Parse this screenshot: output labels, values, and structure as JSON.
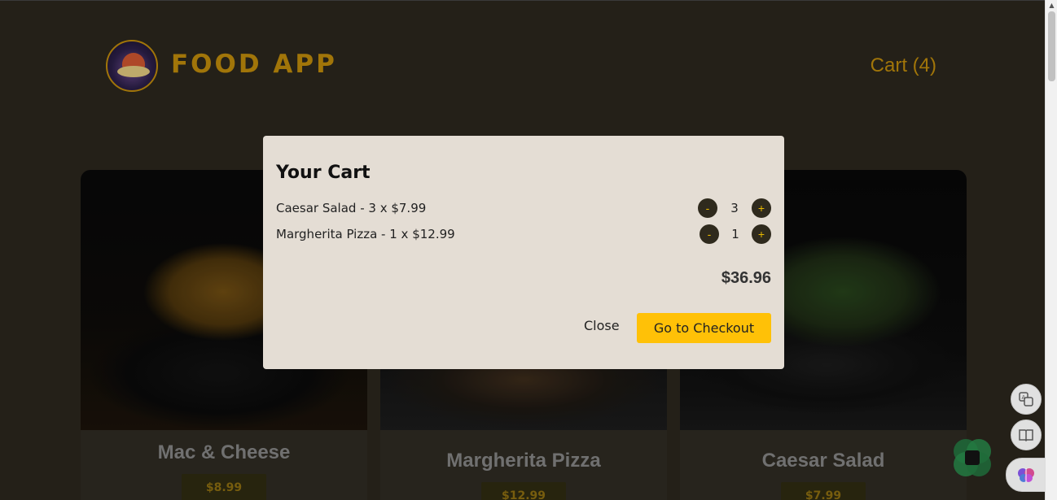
{
  "header": {
    "app_title": "FOOD APP",
    "cart_link": "Cart (4)"
  },
  "menu": {
    "items": [
      {
        "name": "Mac & Cheese",
        "price": "$8.99"
      },
      {
        "name": "Margherita Pizza",
        "price": "$12.99"
      },
      {
        "name": "Caesar Salad",
        "price": "$7.99"
      }
    ]
  },
  "modal": {
    "title": "Your Cart",
    "items": [
      {
        "description": "Caesar Salad - 3 x $7.99",
        "quantity": "3"
      },
      {
        "description": "Margherita Pizza - 1 x $12.99",
        "quantity": "1"
      }
    ],
    "decrement_label": "-",
    "increment_label": "+",
    "total": "$36.96",
    "close_label": "Close",
    "checkout_label": "Go to Checkout"
  },
  "colors": {
    "background": "#29251c",
    "accent": "#b8860b",
    "checkout_button": "#ffc107",
    "modal_background": "#e4ddd4"
  },
  "icons": {
    "translate": "translate-icon",
    "reader": "book-icon",
    "ai": "brain-icon",
    "assistant": "assistant-icon"
  }
}
